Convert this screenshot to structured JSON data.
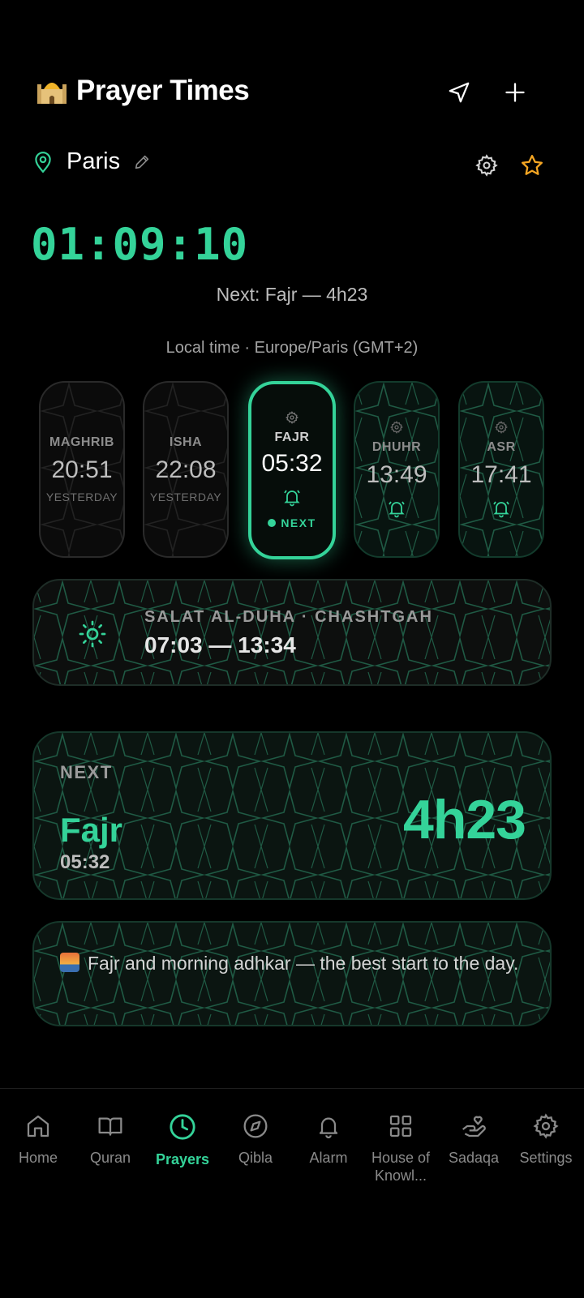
{
  "header": {
    "title": "Prayer Times",
    "icons": [
      "location-arrow-icon",
      "plus-icon"
    ]
  },
  "city": {
    "name": "Paris"
  },
  "clock": "01:09:10",
  "next_line": "Next: Fajr — 4h23",
  "local_time_line": "Local time · Europe/Paris (GMT+2)",
  "prayers": [
    {
      "name": "MAGHRIB",
      "time": "20:51",
      "sub": "YESTERDAY",
      "state": "past"
    },
    {
      "name": "ISHA",
      "time": "22:08",
      "sub": "YESTERDAY",
      "state": "past"
    },
    {
      "name": "FAJR",
      "time": "05:32",
      "sub": "NEXT",
      "state": "next"
    },
    {
      "name": "DHUHR",
      "time": "13:49",
      "sub": "",
      "state": "future"
    },
    {
      "name": "ASR",
      "time": "17:41",
      "sub": "",
      "state": "future"
    }
  ],
  "duha": {
    "label": "SALAT AL-DUHA · CHASHTGAH",
    "range": "07:03 — 13:34"
  },
  "next_card": {
    "label": "NEXT",
    "name": "Fajr",
    "time": "05:32",
    "countdown": "4h23"
  },
  "tip": {
    "text": "Fajr and morning adhkar — the best start to the day."
  },
  "nav": [
    {
      "label": "Home",
      "icon": "home-icon"
    },
    {
      "label": "Quran",
      "icon": "book-icon"
    },
    {
      "label": "Prayers",
      "icon": "clock-icon",
      "active": true
    },
    {
      "label": "Qibla",
      "icon": "compass-icon"
    },
    {
      "label": "Alarm",
      "icon": "bell-icon"
    },
    {
      "label": "House of Knowl...",
      "icon": "grid-icon"
    },
    {
      "label": "Sadaqa",
      "icon": "charity-icon"
    },
    {
      "label": "Settings",
      "icon": "gear-icon"
    }
  ],
  "colors": {
    "accent": "#34d399",
    "star": "#f5a623",
    "background": "#000000"
  }
}
